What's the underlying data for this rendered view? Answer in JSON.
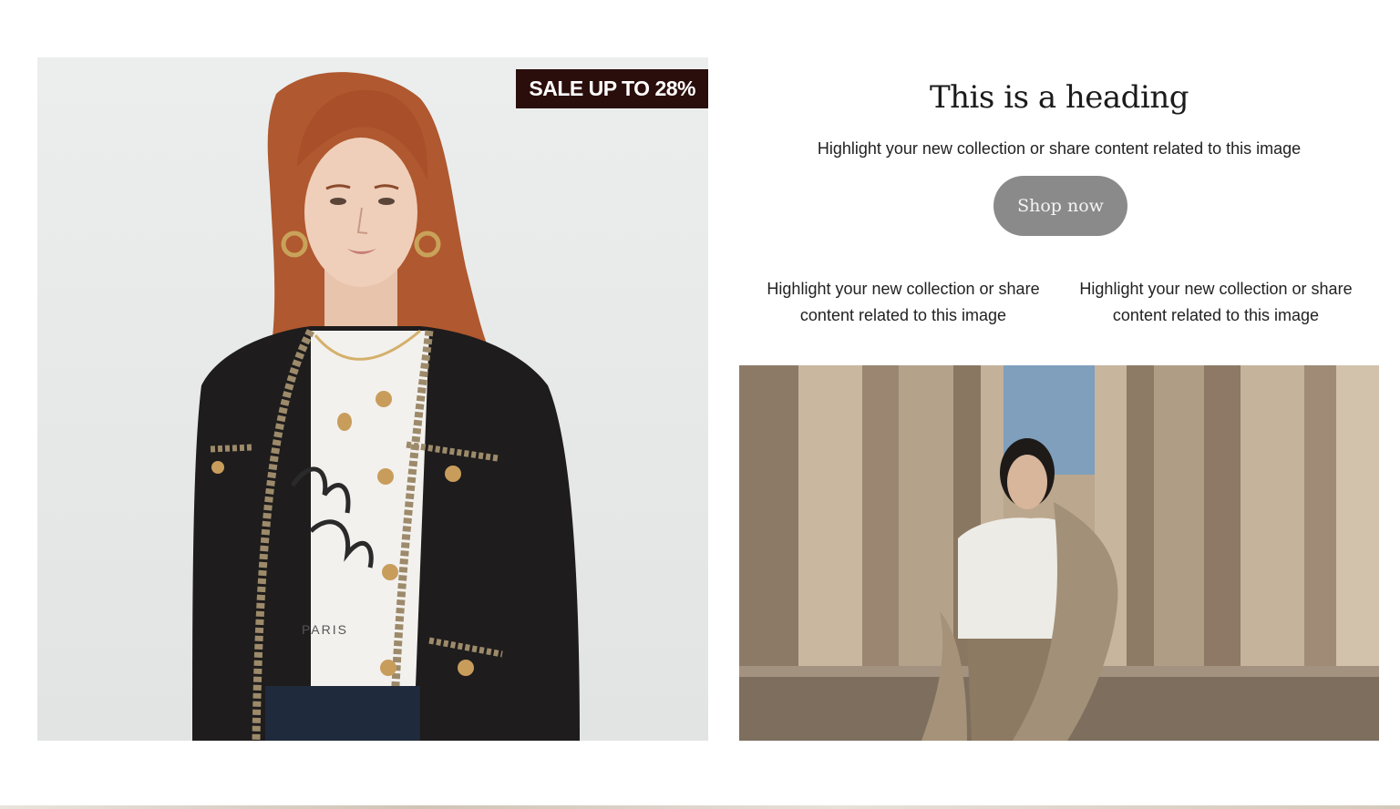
{
  "hero": {
    "badge": "SALE UP TO 28%",
    "shirt_text": "PARIS"
  },
  "content": {
    "heading": "This is a heading",
    "subtext": "Highlight your new collection or share content related to this image",
    "button_label": "Shop now",
    "columns": [
      {
        "line1": "Highlight your new collection or share",
        "line2": "content related to this image"
      },
      {
        "line1": "Highlight your new collection or share",
        "line2": "content related to this image"
      }
    ]
  },
  "colors": {
    "badge_bg": "#2a0e0c",
    "button_bg": "#8a8a8a",
    "text": "#222222"
  }
}
